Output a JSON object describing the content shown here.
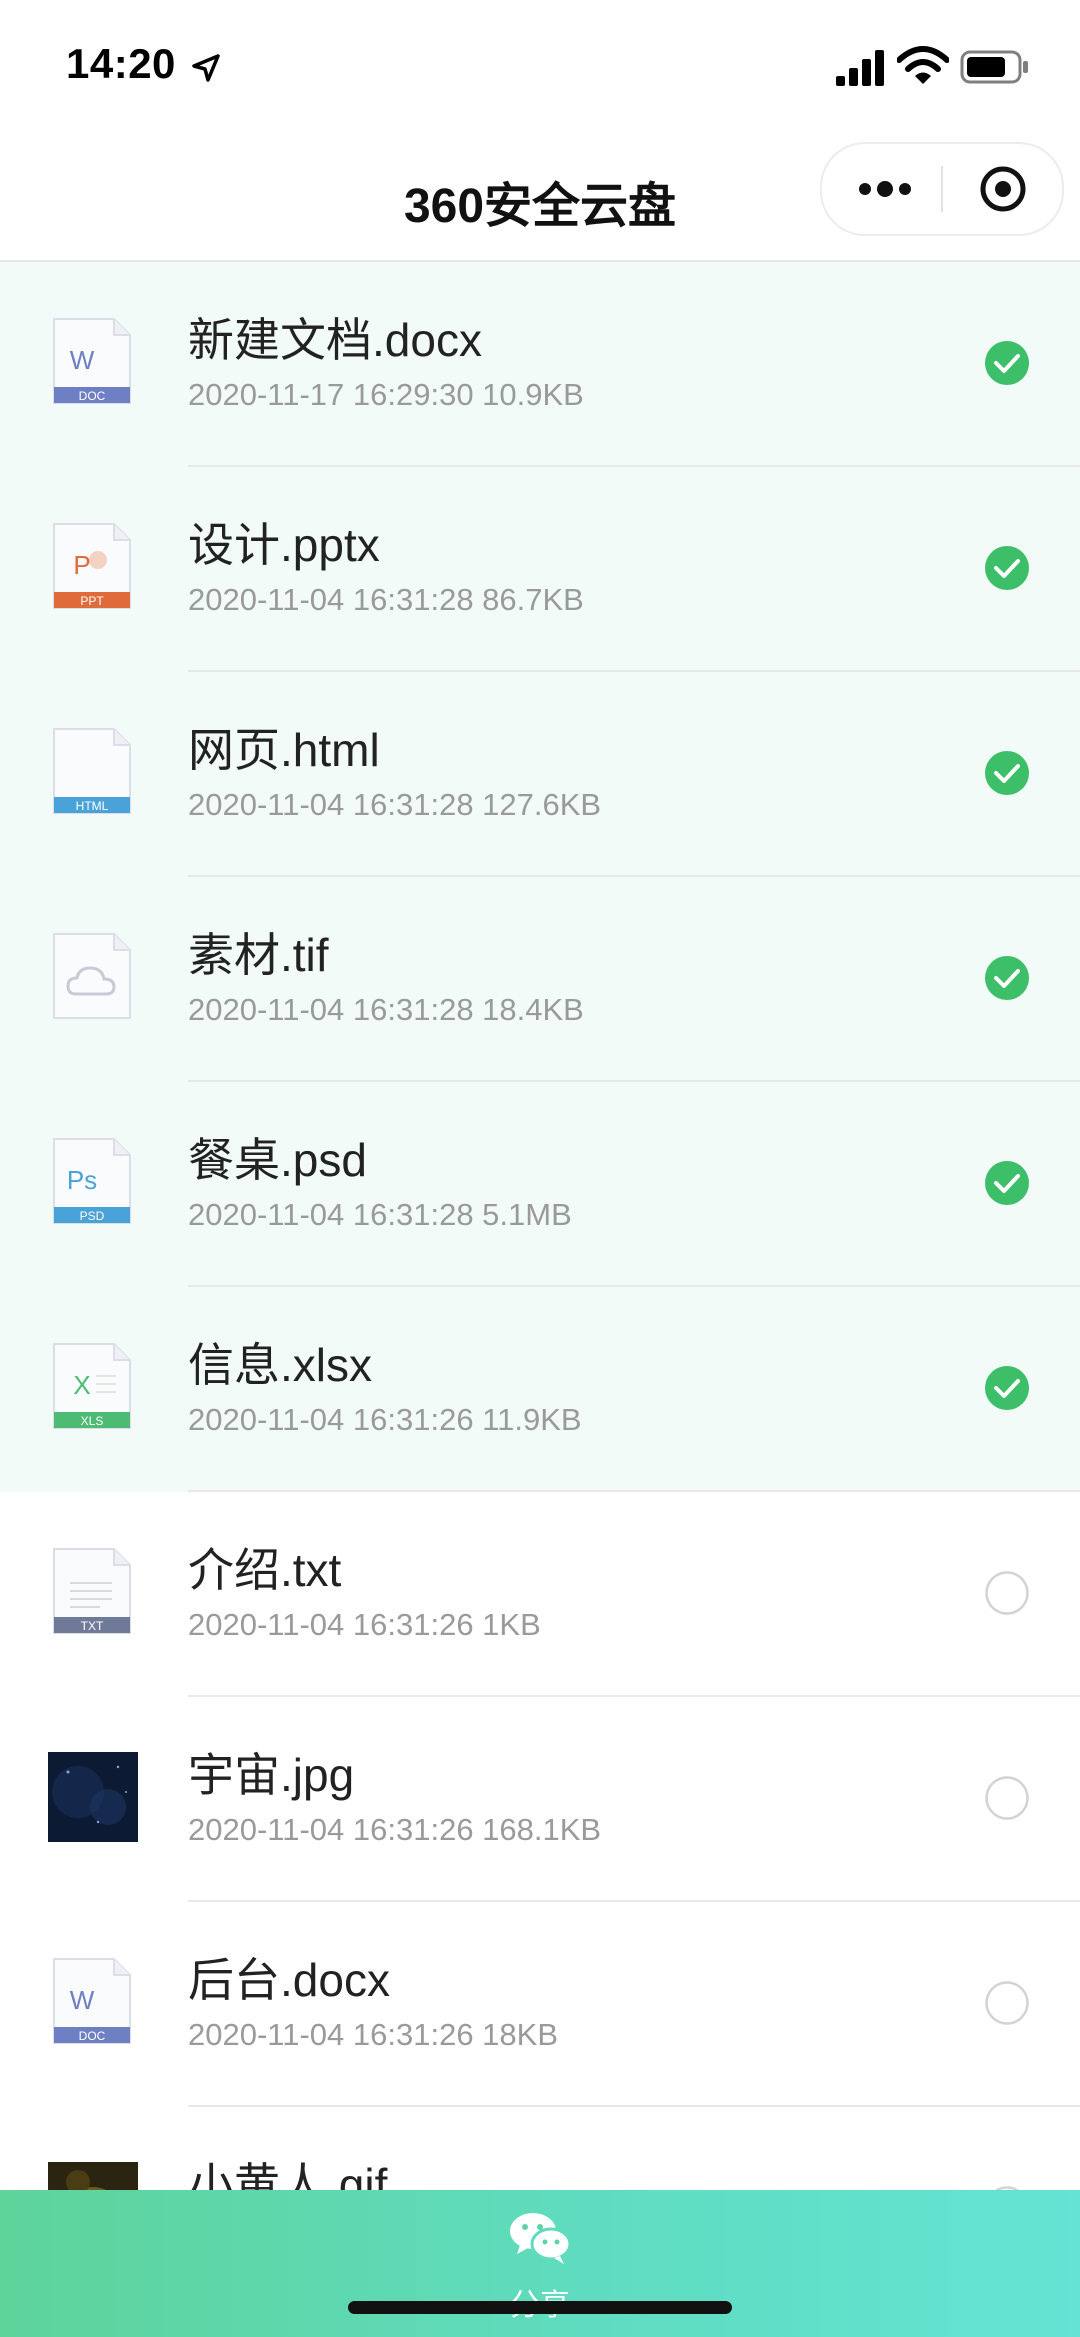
{
  "status_bar": {
    "time": "14:20"
  },
  "nav": {
    "title": "360安全云盘"
  },
  "files": [
    {
      "name": "新建文档.docx",
      "meta": "2020-11-17 16:29:30 10.9KB",
      "type": "doc",
      "label": "DOC",
      "glyph": "W",
      "selected": true
    },
    {
      "name": "设计.pptx",
      "meta": "2020-11-04 16:31:28 86.7KB",
      "type": "ppt",
      "label": "PPT",
      "glyph": "P",
      "selected": true
    },
    {
      "name": "网页.html",
      "meta": "2020-11-04 16:31:28 127.6KB",
      "type": "html",
      "label": "HTML",
      "glyph": "</>",
      "selected": true
    },
    {
      "name": "素材.tif",
      "meta": "2020-11-04 16:31:28 18.4KB",
      "type": "cloud",
      "label": "",
      "glyph": "",
      "selected": true
    },
    {
      "name": "餐桌.psd",
      "meta": "2020-11-04 16:31:28 5.1MB",
      "type": "psd",
      "label": "PSD",
      "glyph": "Ps",
      "selected": true
    },
    {
      "name": "信息.xlsx",
      "meta": "2020-11-04 16:31:26 11.9KB",
      "type": "xls",
      "label": "XLS",
      "glyph": "X",
      "selected": true
    },
    {
      "name": "介绍.txt",
      "meta": "2020-11-04 16:31:26 1KB",
      "type": "txt",
      "label": "TXT",
      "glyph": "",
      "selected": false
    },
    {
      "name": "宇宙.jpg",
      "meta": "2020-11-04 16:31:26 168.1KB",
      "type": "image-space",
      "label": "",
      "glyph": "",
      "selected": false
    },
    {
      "name": "后台.docx",
      "meta": "2020-11-04 16:31:26 18KB",
      "type": "doc",
      "label": "DOC",
      "glyph": "W",
      "selected": false
    },
    {
      "name": "小黄人.gif",
      "meta": "",
      "type": "image-minion",
      "label": "",
      "glyph": "",
      "selected": false
    }
  ],
  "bottom_bar": {
    "share_label": "分享"
  },
  "colors": {
    "check_green": "#3dbf6a",
    "selected_row_bg": "#f2fbf8",
    "doc": "#6f7fc3",
    "ppt": "#e06b3a",
    "html": "#4aa3d8",
    "psd": "#4aa3d8",
    "xls": "#4dbb73",
    "txt": "#6f7a99"
  },
  "icons": {
    "location": "location-arrow-icon",
    "signal": "cellular-signal-icon",
    "wifi": "wifi-icon",
    "battery": "battery-icon",
    "more": "more-dots-icon",
    "close": "target-circle-icon",
    "share": "wechat-icon"
  }
}
